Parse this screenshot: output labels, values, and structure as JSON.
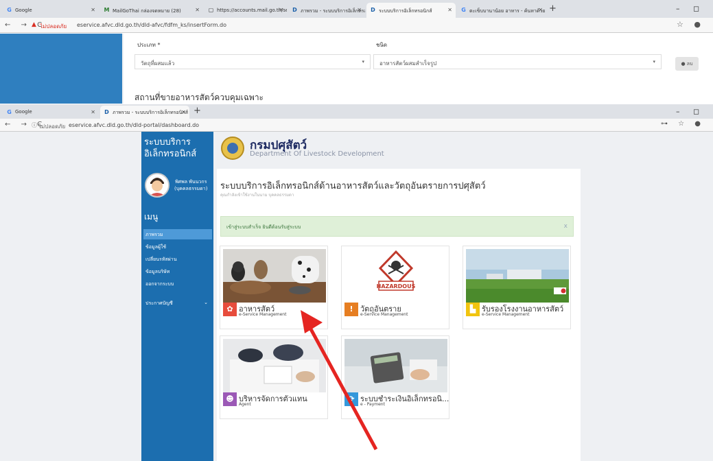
{
  "browser1": {
    "tabs": [
      {
        "label": "Google",
        "icon": "G"
      },
      {
        "label": "MailGoThai กล่องจดหมาย (28)",
        "icon": "M"
      },
      {
        "label": "https://accounts.mail.go.th/serv",
        "icon": "▢"
      },
      {
        "label": "ภาพรวม - ระบบบริการอิเล็กทรอนิกส์",
        "icon": "D"
      },
      {
        "label": "ระบบบริการอิเล็กทรอนิกส์",
        "icon": "D"
      },
      {
        "label": "ตะเข็บบานาน้อย อาหาร - ค้นหาด้วย",
        "icon": "G"
      }
    ],
    "security": "ไม่ปลอดภัย",
    "url": "eservice.afvc.dld.go.th/dld-afvc/fdfm_ks/insertForm.do",
    "window_controls": "– ◻"
  },
  "form": {
    "type_label": "ประเภท *",
    "type_value": "วัตถุที่ผสมแล้ว",
    "kind_label": "ชนิด",
    "kind_value": "อาหารสัตว์ผสมสำเร็จรูป",
    "delete_button": "ลบ",
    "section_title": "สถานที่ขายอาหารสัตว์ควบคุมเฉพาะ"
  },
  "browser2": {
    "tabs": [
      {
        "label": "Google",
        "icon": "G"
      },
      {
        "label": "ภาพรวม - ระบบบริการอิเล็กทรอนิกส์",
        "icon": "D"
      }
    ],
    "security": "ไม่ปลอดภัย",
    "url": "eservice.afvc.dld.go.th/dld-portal/dashboard.do"
  },
  "header": {
    "brand_line1": "ระบบบริการ",
    "brand_line2": "อิเล็กทรอนิกส์",
    "dept_name": "กรมปศุสัตว์",
    "dept_name_en": "Department Of Livestock Development"
  },
  "user": {
    "name": "พิศพล พันนวกร",
    "role": "(บุคคลธรรมดา)"
  },
  "menu": {
    "title": "เมนู",
    "items": [
      "ภาพรวม",
      "ข้อมูลผู้ใช้",
      "เปลี่ยนรหัสผ่าน",
      "ข้อมูลบริษัท",
      "ออกจากระบบ"
    ],
    "announce": "ประกาศบัญชี"
  },
  "main": {
    "title": "ระบบบริการอิเล็กทรอนิกส์ด้านอาหารสัตว์และวัตถุอันตรายการปศุสัตว์",
    "subtitle": "คุณกำลังเข้าใช้งานในนาม บุคคลธรรมดา",
    "alert": "เข้าสู่ระบบสำเร็จ ยินดีต้อนรับสู่ระบบ",
    "alert_close": "x"
  },
  "cards": [
    {
      "title": "อาหารสัตว์",
      "sub": "e-Service Management",
      "color": "#e74c3c",
      "icon": "paw-icon"
    },
    {
      "title": "วัตถุอันตราย",
      "sub": "e-Service Management",
      "color": "#e67e22",
      "icon": "warning-icon"
    },
    {
      "title": "รับรองโรงงานอาหารสัตว์",
      "sub": "e-Service Management",
      "color": "#f1c40f",
      "icon": "factory-icon"
    },
    {
      "title": "บริหารจัดการตัวแทน",
      "sub": "Agent",
      "color": "#9b59b6",
      "icon": "people-icon"
    },
    {
      "title": "ระบบชำระเงินอิเล็กทรอนิ...",
      "sub": "e - Payment",
      "color": "#3498db",
      "icon": "payment-icon"
    }
  ],
  "hazard_label": "HAZARDOUS"
}
